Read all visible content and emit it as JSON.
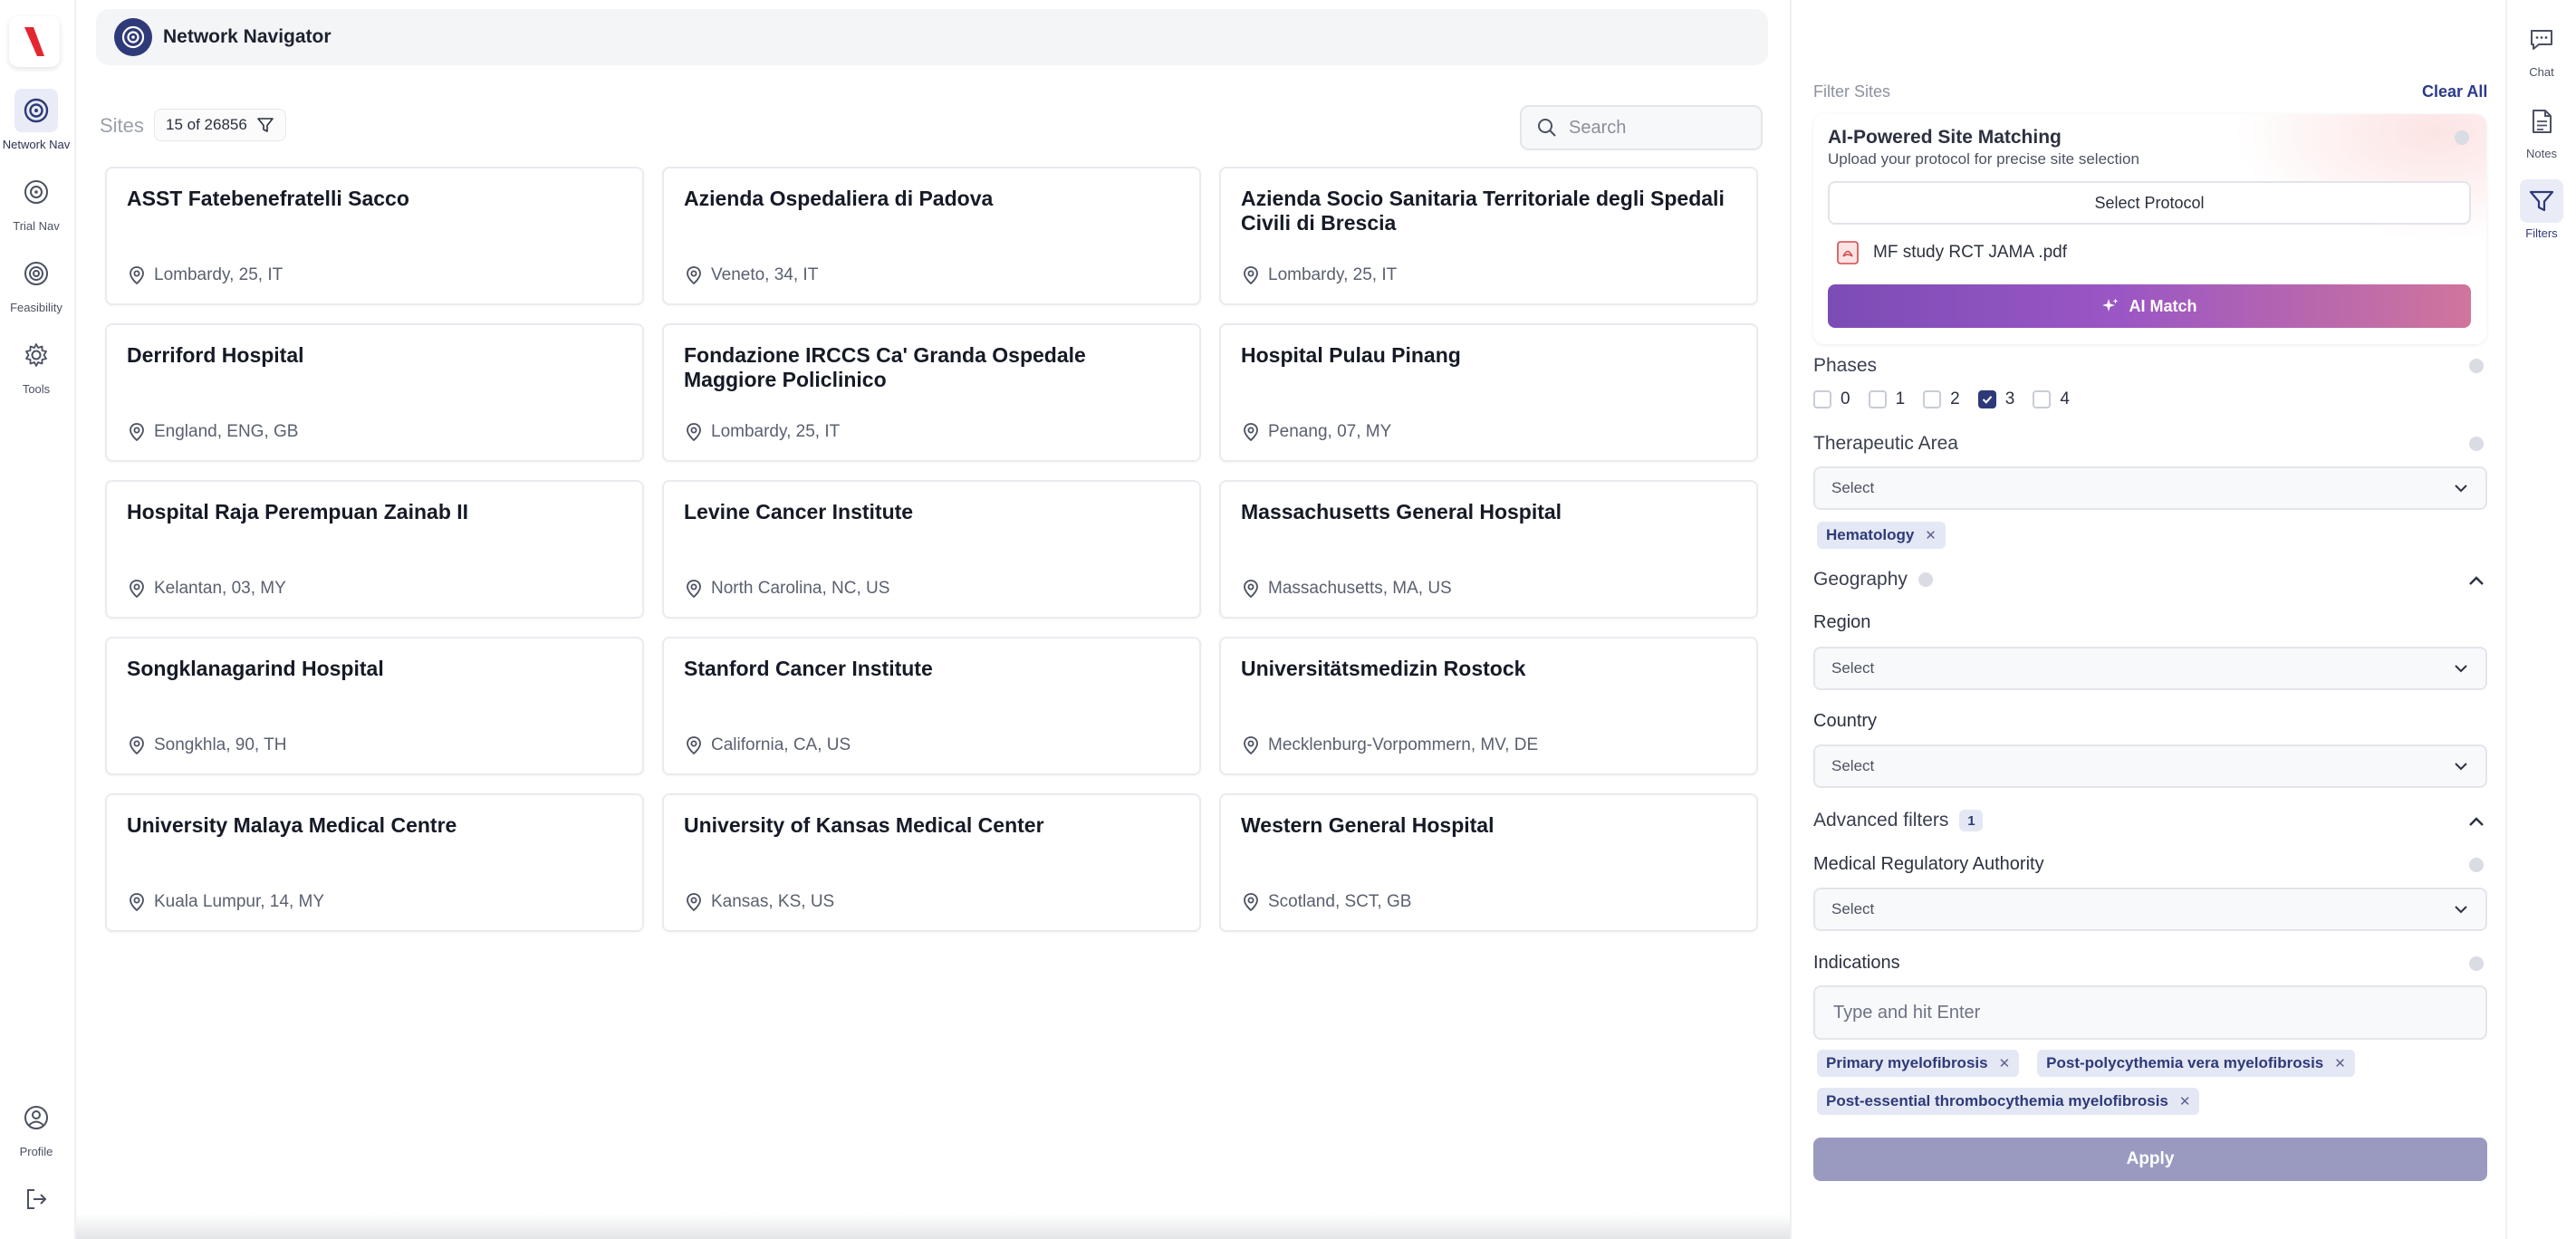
{
  "app": {
    "title": "Network Navigator"
  },
  "left_nav": {
    "items": [
      {
        "label": "Network Nav",
        "icon": "network-icon"
      },
      {
        "label": "Trial Nav",
        "icon": "target-icon"
      },
      {
        "label": "Feasibility",
        "icon": "feasibility-icon"
      },
      {
        "label": "Tools",
        "icon": "gear-icon"
      }
    ],
    "profile": {
      "label": "Profile",
      "icon": "user-circle-icon"
    },
    "logout_icon": "logout-icon"
  },
  "sites": {
    "label": "Sites",
    "count": "15 of 26856",
    "search_placeholder": "Search",
    "cards": [
      {
        "name": "ASST Fatebenefratelli Sacco",
        "location": "Lombardy, 25, IT"
      },
      {
        "name": "Azienda Ospedaliera di Padova",
        "location": "Veneto, 34, IT"
      },
      {
        "name": "Azienda Socio Sanitaria Territoriale degli Spedali Civili di Brescia",
        "location": "Lombardy, 25, IT"
      },
      {
        "name": "Derriford Hospital",
        "location": "England, ENG, GB"
      },
      {
        "name": "Fondazione IRCCS Ca' Granda Ospedale Maggiore Policlinico",
        "location": "Lombardy, 25, IT"
      },
      {
        "name": "Hospital Pulau Pinang",
        "location": "Penang, 07, MY"
      },
      {
        "name": "Hospital Raja Perempuan Zainab II",
        "location": "Kelantan, 03, MY"
      },
      {
        "name": "Levine Cancer Institute",
        "location": "North Carolina, NC, US"
      },
      {
        "name": "Massachusetts General Hospital",
        "location": "Massachusetts, MA, US"
      },
      {
        "name": "Songklanagarind Hospital",
        "location": "Songkhla, 90, TH"
      },
      {
        "name": "Stanford Cancer Institute",
        "location": "California, CA, US"
      },
      {
        "name": "Universitätsmedizin Rostock",
        "location": "Mecklenburg-Vorpommern, MV, DE"
      },
      {
        "name": "University Malaya Medical Centre",
        "location": "Kuala Lumpur, 14, MY"
      },
      {
        "name": "University of Kansas Medical Center",
        "location": "Kansas, KS, US"
      },
      {
        "name": "Western General Hospital",
        "location": "Scotland, SCT, GB"
      }
    ]
  },
  "filters": {
    "header": "Filter Sites",
    "clear_all": "Clear All",
    "ai": {
      "title": "AI-Powered Site Matching",
      "subtitle": "Upload your protocol for precise site selection",
      "select_protocol": "Select Protocol",
      "file_name": "MF study RCT JAMA .pdf",
      "ai_match": "AI Match"
    },
    "phases": {
      "title": "Phases",
      "options": [
        {
          "label": "0",
          "checked": false
        },
        {
          "label": "1",
          "checked": false
        },
        {
          "label": "2",
          "checked": false
        },
        {
          "label": "3",
          "checked": true
        },
        {
          "label": "4",
          "checked": false
        }
      ]
    },
    "therapeutic_area": {
      "title": "Therapeutic Area",
      "placeholder": "Select",
      "chips": [
        "Hematology"
      ]
    },
    "geography": {
      "title": "Geography",
      "region": {
        "label": "Region",
        "placeholder": "Select"
      },
      "country": {
        "label": "Country",
        "placeholder": "Select"
      }
    },
    "advanced": {
      "title": "Advanced filters",
      "count": "1",
      "mra": {
        "label": "Medical Regulatory Authority",
        "placeholder": "Select"
      },
      "indications": {
        "label": "Indications",
        "placeholder": "Type and hit Enter",
        "chips": [
          "Primary myelofibrosis",
          "Post-polycythemia vera myelofibrosis",
          "Post-essential thrombocythemia myelofibrosis"
        ]
      }
    },
    "apply": "Apply"
  },
  "right_nav": {
    "items": [
      {
        "label": "Chat",
        "icon": "chat-icon"
      },
      {
        "label": "Notes",
        "icon": "notes-icon"
      },
      {
        "label": "Filters",
        "icon": "filter-icon"
      }
    ]
  },
  "colors": {
    "accent": "#2e3a78",
    "ai_gradient_start": "#7c4cb6",
    "ai_gradient_end": "#d0759c",
    "apply_disabled": "#9a9ac1",
    "logo_red": "#e3262f"
  }
}
